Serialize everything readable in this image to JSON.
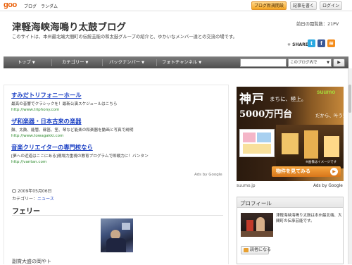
{
  "goobar": {
    "logo": "goo",
    "links": [
      "ブログ",
      "ランダム"
    ],
    "buttons": {
      "new_blog": "ブログ新規開設",
      "write": "記事を書く",
      "login": "ログイン"
    }
  },
  "header": {
    "title": "津軽海峡海鳴り太鼓ブログ",
    "description": "このサイトは、本州最北端大間町の伝統芸能の和太鼓グループの紹介と、ゆかいなメンバー達との交流の場です。",
    "views": "前日の閲覧数：21PV",
    "share_label": "+ SHARE",
    "share_icons": [
      "twitter-icon",
      "facebook-icon",
      "rss-icon"
    ]
  },
  "nav": {
    "items": [
      "トップ",
      "カテゴリー",
      "バックナンバー",
      "フォトチャンネル"
    ],
    "search_scope": "このブログ内で",
    "go_label": "▶"
  },
  "ads": [
    {
      "title": "すみだトリフォニーホール",
      "desc": "最高の音響でクラシックを！最新公演スケジュールはこちら",
      "url": "http://www.triphony.com"
    },
    {
      "title": "ザ和楽器・日本古来の楽器",
      "desc": "鼓、太鼓、能管、篠笛、笙、琴など能楽の和楽器を動画と写真で説明",
      "url": "http://www.towagakki.com"
    },
    {
      "title": "音楽クリエイターの専門校なら",
      "desc": "[夢への近道はここにある]現場力重視の教育プログラムで即戦力に！バンタン",
      "url": "http://vantan.com"
    }
  ],
  "ads_by": "Ads by Google",
  "post": {
    "date": "2009年05月06日",
    "category_label": "カテゴリー：",
    "category": "ニュース",
    "title": "フェリー",
    "more": "副賞大盛の岡やト"
  },
  "banner": {
    "brand": "suumo",
    "city": "神戸",
    "tagline": "まちに、極上。",
    "price": "5000万円台",
    "price_sub": "だから、叶う贅沢",
    "note": "※画像はイメージです",
    "cta": "物件を見てみる"
  },
  "banner_footer": {
    "site": "suumo.jp",
    "ads_by": "Ads by Google"
  },
  "profile": {
    "heading": "プロフィール",
    "text": "津軽海峡海鳴り太鼓は本州最北端、大間町の伝承芸能です。",
    "reader_button": "読者になる"
  },
  "colors": {
    "goo_orange": "#e85a00",
    "nav_bg": "#5e5e5e",
    "ad_link": "#1a3fc4",
    "ad_url": "#2b8a2b",
    "suumo_green": "#a6dd3a"
  }
}
